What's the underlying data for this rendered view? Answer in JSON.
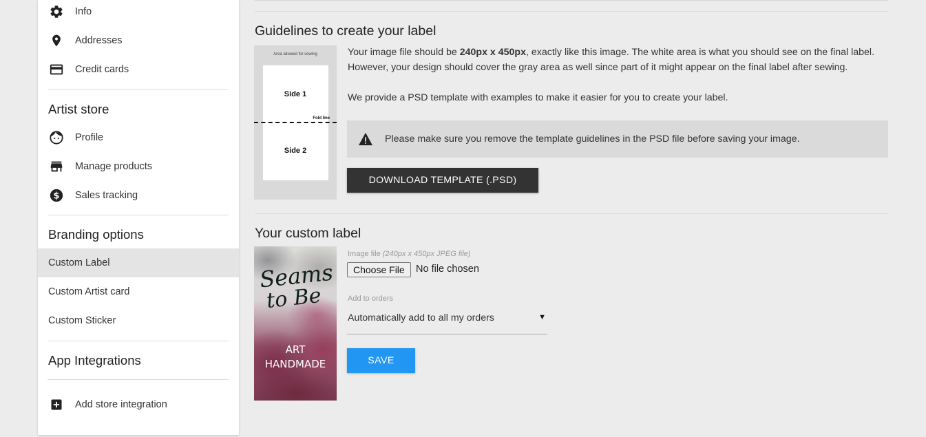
{
  "sidebar": {
    "account_items": [
      {
        "label": "Info",
        "icon": "gear-icon"
      },
      {
        "label": "Addresses",
        "icon": "location-pin-icon"
      },
      {
        "label": "Credit cards",
        "icon": "credit-card-icon"
      }
    ],
    "artist_store": {
      "title": "Artist store",
      "items": [
        {
          "label": "Profile",
          "icon": "face-icon"
        },
        {
          "label": "Manage products",
          "icon": "store-icon"
        },
        {
          "label": "Sales tracking",
          "icon": "dollar-circle-icon"
        }
      ]
    },
    "branding": {
      "title": "Branding options",
      "items": [
        {
          "label": "Custom Label",
          "active": true
        },
        {
          "label": "Custom Artist card",
          "active": false
        },
        {
          "label": "Custom Sticker",
          "active": false
        }
      ]
    },
    "integrations": {
      "title": "App Integrations",
      "add_label": "Add store integration",
      "add_icon": "plus-box-icon"
    }
  },
  "guidelines": {
    "title": "Guidelines to create your label",
    "image": {
      "area_text": "Area allowed for sewing",
      "side1": "Side 1",
      "side2": "Side 2",
      "fold": "Fold line"
    },
    "para1_pre": "Your image file should be ",
    "para1_bold": "240px x 450px",
    "para1_post": ", exactly like this image. The white area is what you should see on the final label. However, your design should cover the gray area as well since part of it might appear on the final label after sewing.",
    "para2": "We provide a PSD template with examples to make it easier for you to create your label.",
    "warning": "Please make sure you remove the template guidelines in the PSD file before saving your image.",
    "warning_icon": "warning-triangle-icon",
    "download_label": "DOWNLOAD TEMPLATE (.PSD)"
  },
  "custom_label": {
    "title": "Your custom label",
    "preview": {
      "line1": "Seams",
      "line2": "to Be",
      "line3": "ART",
      "line4": "HANDMADE"
    },
    "image_field_label": "Image file",
    "image_field_hint": "(240px x 450px JPEG file)",
    "choose_file": "Choose File",
    "no_file": "No file chosen",
    "orders_label": "Add to orders",
    "orders_value": "Automatically add to all my orders",
    "save_label": "SAVE"
  },
  "colors": {
    "accent": "#2196f3",
    "dark_button": "#333333",
    "active_nav": "#e4e4e4"
  }
}
